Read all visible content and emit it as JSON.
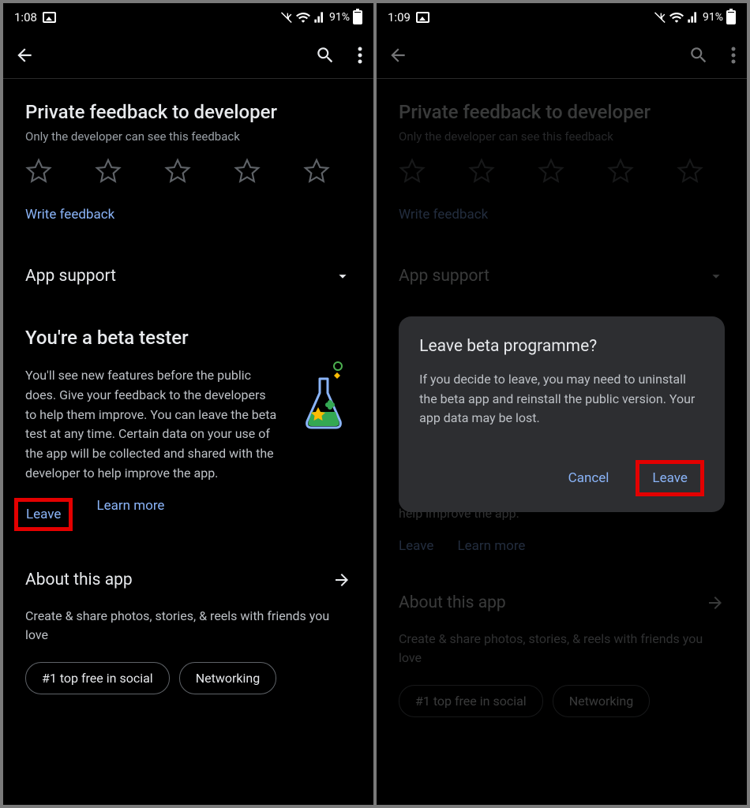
{
  "left": {
    "status": {
      "time": "1:08",
      "battery_pct": "91%"
    },
    "feedback": {
      "title": "Private feedback to developer",
      "subtitle": "Only the developer can see this feedback",
      "write_link": "Write feedback"
    },
    "app_support_label": "App support",
    "beta": {
      "title": "You're a beta tester",
      "body": "You'll see new features before the public does. Give your feedback to the developers to help them improve. You can leave the beta test at any time. Certain data on your use of the app will be collected and shared with the developer to help improve the app.",
      "leave_label": "Leave",
      "learn_more_label": "Learn more"
    },
    "about": {
      "title": "About this app",
      "desc": "Create & share photos, stories, & reels with friends you love",
      "chip1": "#1 top free in social",
      "chip2": "Networking"
    }
  },
  "right": {
    "status": {
      "time": "1:09",
      "battery_pct": "91%"
    },
    "feedback": {
      "title": "Private feedback to developer",
      "subtitle": "Only the developer can see this feedback",
      "write_link": "Write feedback"
    },
    "app_support_label": "App support",
    "beta": {
      "body_tail": "app will be collected and shared with the developer to help improve the app.",
      "leave_label": "Leave",
      "learn_more_label": "Learn more"
    },
    "about": {
      "title": "About this app",
      "desc": "Create & share photos, stories, & reels with friends you love",
      "chip1": "#1 top free in social",
      "chip2": "Networking"
    },
    "modal": {
      "title": "Leave beta programme?",
      "body": "If you decide to leave, you may need to uninstall the beta app and reinstall the public version. Your app data may be lost.",
      "cancel_label": "Cancel",
      "leave_label": "Leave"
    }
  }
}
